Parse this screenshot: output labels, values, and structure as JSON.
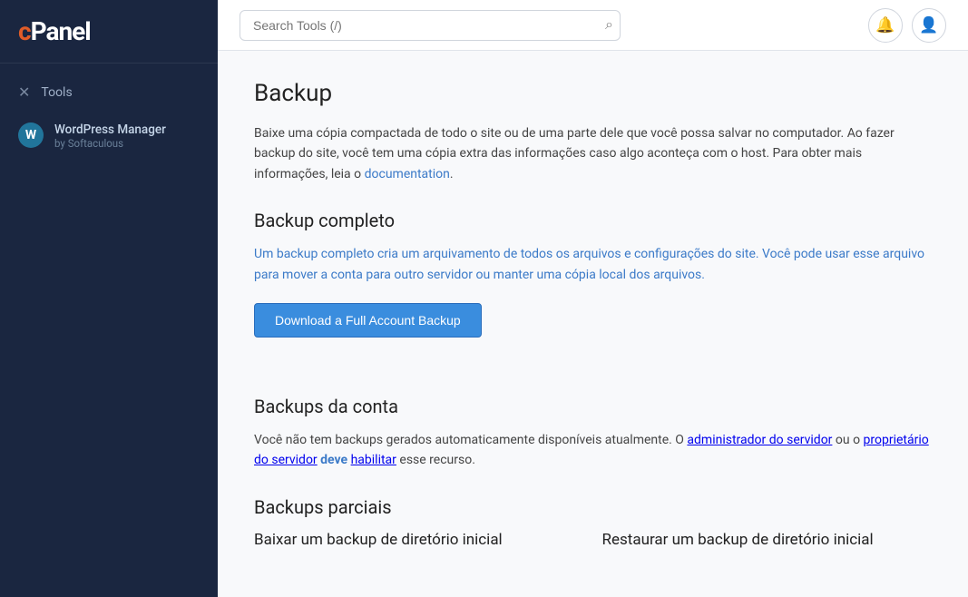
{
  "sidebar": {
    "logo": "cPanel",
    "items": [
      {
        "id": "tools",
        "label": "Tools",
        "icon": "✕"
      }
    ],
    "wp_manager": {
      "title": "WordPress Manager",
      "subtitle": "by Softaculous"
    }
  },
  "header": {
    "search_placeholder": "Search Tools (/)",
    "search_icon": "🔍",
    "notifications_icon": "🔔",
    "user_icon": "👤"
  },
  "content": {
    "page_title": "Backup",
    "intro": "Baixe uma cópia compactada de todo o site ou de uma parte dele que você possa salvar no computador. Ao fazer backup do site, você tem uma cópia extra das informações caso algo aconteça com o host. Para obter mais informações, leia o",
    "intro_link": "documentation",
    "intro_end": ".",
    "backup_completo": {
      "title": "Backup completo",
      "description_part1": "Um backup completo cria um arquivamento de todos os arquivos e configurações do site. Você pode usar esse arquivo para mover a conta para outro servidor ou manter uma cópia local dos arquivos.",
      "button_label": "Download a Full Account Backup"
    },
    "backups_conta": {
      "title": "Backups da conta",
      "description": "Você não tem backups gerados automaticamente disponíveis atualmente. O administrador do servidor ou o proprietário do servidor",
      "link1": "administrador do servidor",
      "link2": "proprietário do servidor",
      "description2": "deve",
      "link3": "habilitar",
      "description3": "esse recurso."
    },
    "backups_parciais": {
      "title": "Backups parciais",
      "items": [
        {
          "id": "baixar-home",
          "label": "Baixar um backup de diretório inicial"
        },
        {
          "id": "restaurar-home",
          "label": "Restaurar um backup de diretório inicial"
        }
      ]
    }
  }
}
